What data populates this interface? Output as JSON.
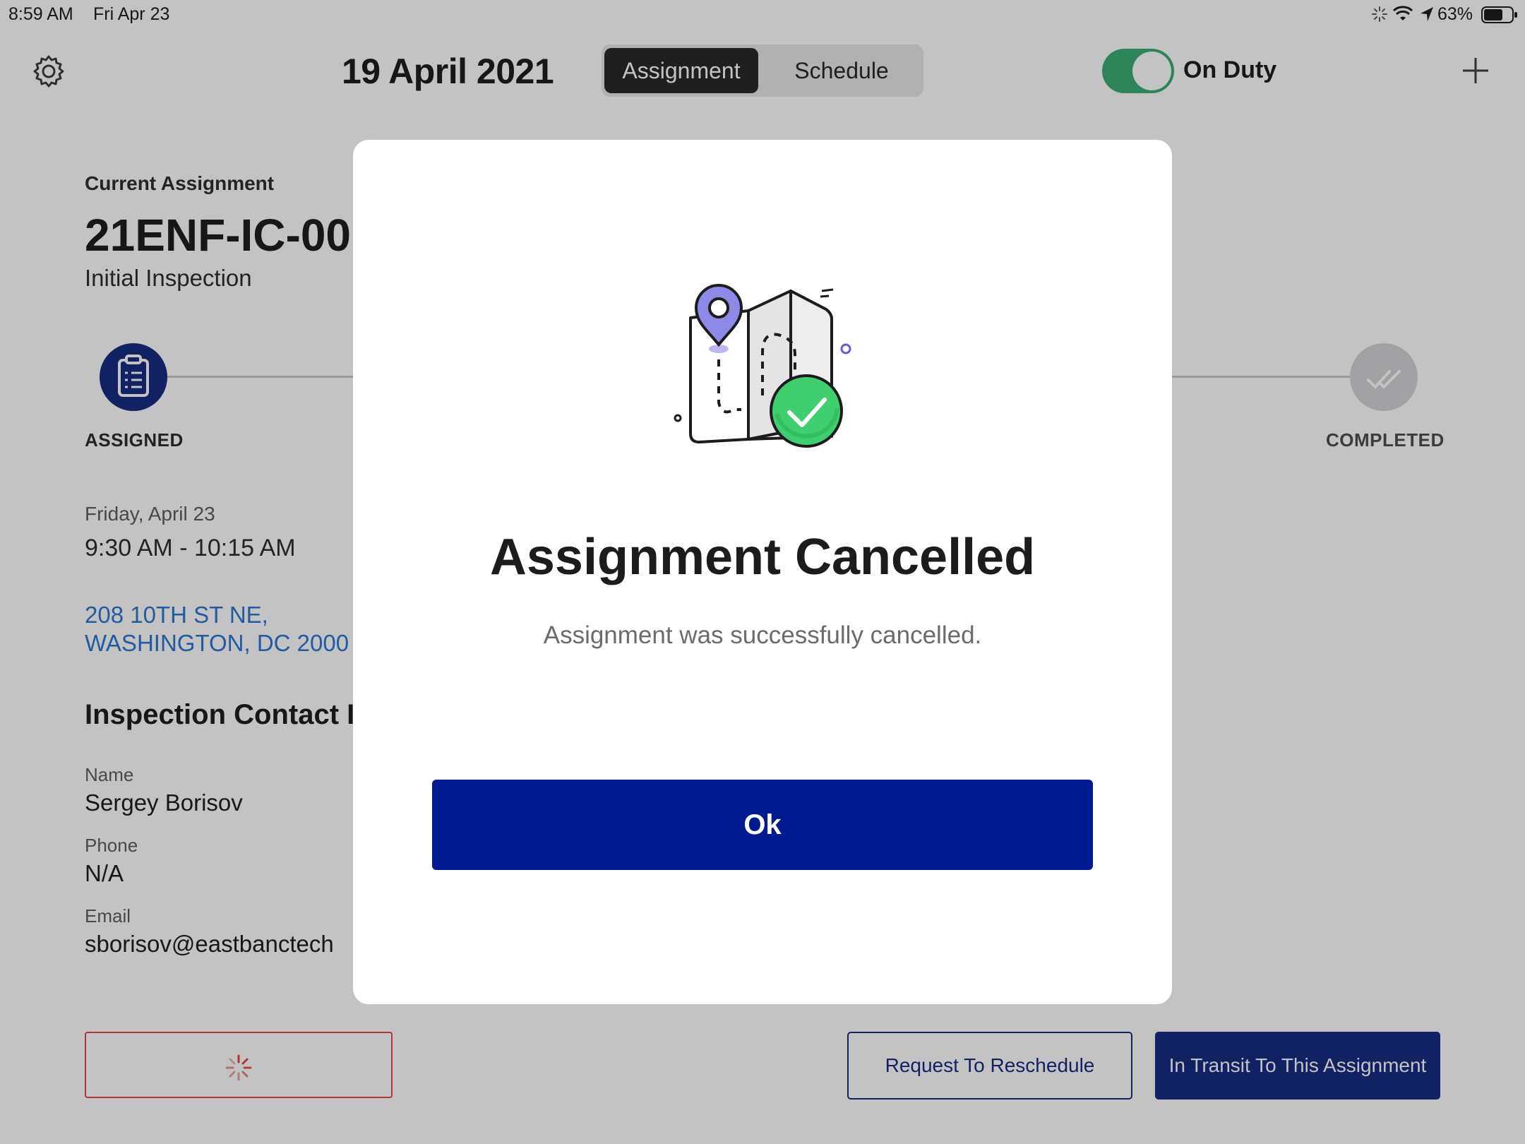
{
  "status_bar": {
    "time": "8:59 AM",
    "date": "Fri Apr 23",
    "battery": "63%"
  },
  "header": {
    "date_title": "19 April 2021",
    "tabs": [
      {
        "label": "Assignment",
        "selected": true
      },
      {
        "label": "Schedule",
        "selected": false
      }
    ],
    "duty_label": "On Duty",
    "duty_on": true
  },
  "assignment": {
    "section_label": "Current Assignment",
    "id": "21ENF-IC-00",
    "type": "Initial Inspection",
    "steps": [
      {
        "label": "ASSIGNED"
      },
      {
        "label": "COMPLETED"
      }
    ],
    "day": "Friday, April 23",
    "time_range": "9:30 AM - 10:15 AM",
    "address_line1": "208 10TH ST NE,",
    "address_line2": "WASHINGTON, DC 2000",
    "contact_heading": "Inspection Contact I",
    "contact": {
      "name_label": "Name",
      "name": "Sergey Borisov",
      "phone_label": "Phone",
      "phone": "N/A",
      "email_label": "Email",
      "email": "sborisov@eastbanctech"
    }
  },
  "actions": {
    "reschedule": "Request To Reschedule",
    "transit": "In Transit To This Assignment"
  },
  "modal": {
    "title": "Assignment Cancelled",
    "message": "Assignment was successfully cancelled.",
    "ok_label": "Ok"
  },
  "colors": {
    "brand_navy": "#0a1f7a",
    "ok_blue": "#001a8f",
    "toggle_green": "#2ea86b",
    "link_blue": "#1f6fd1",
    "cancel_red": "#e33b3b"
  }
}
